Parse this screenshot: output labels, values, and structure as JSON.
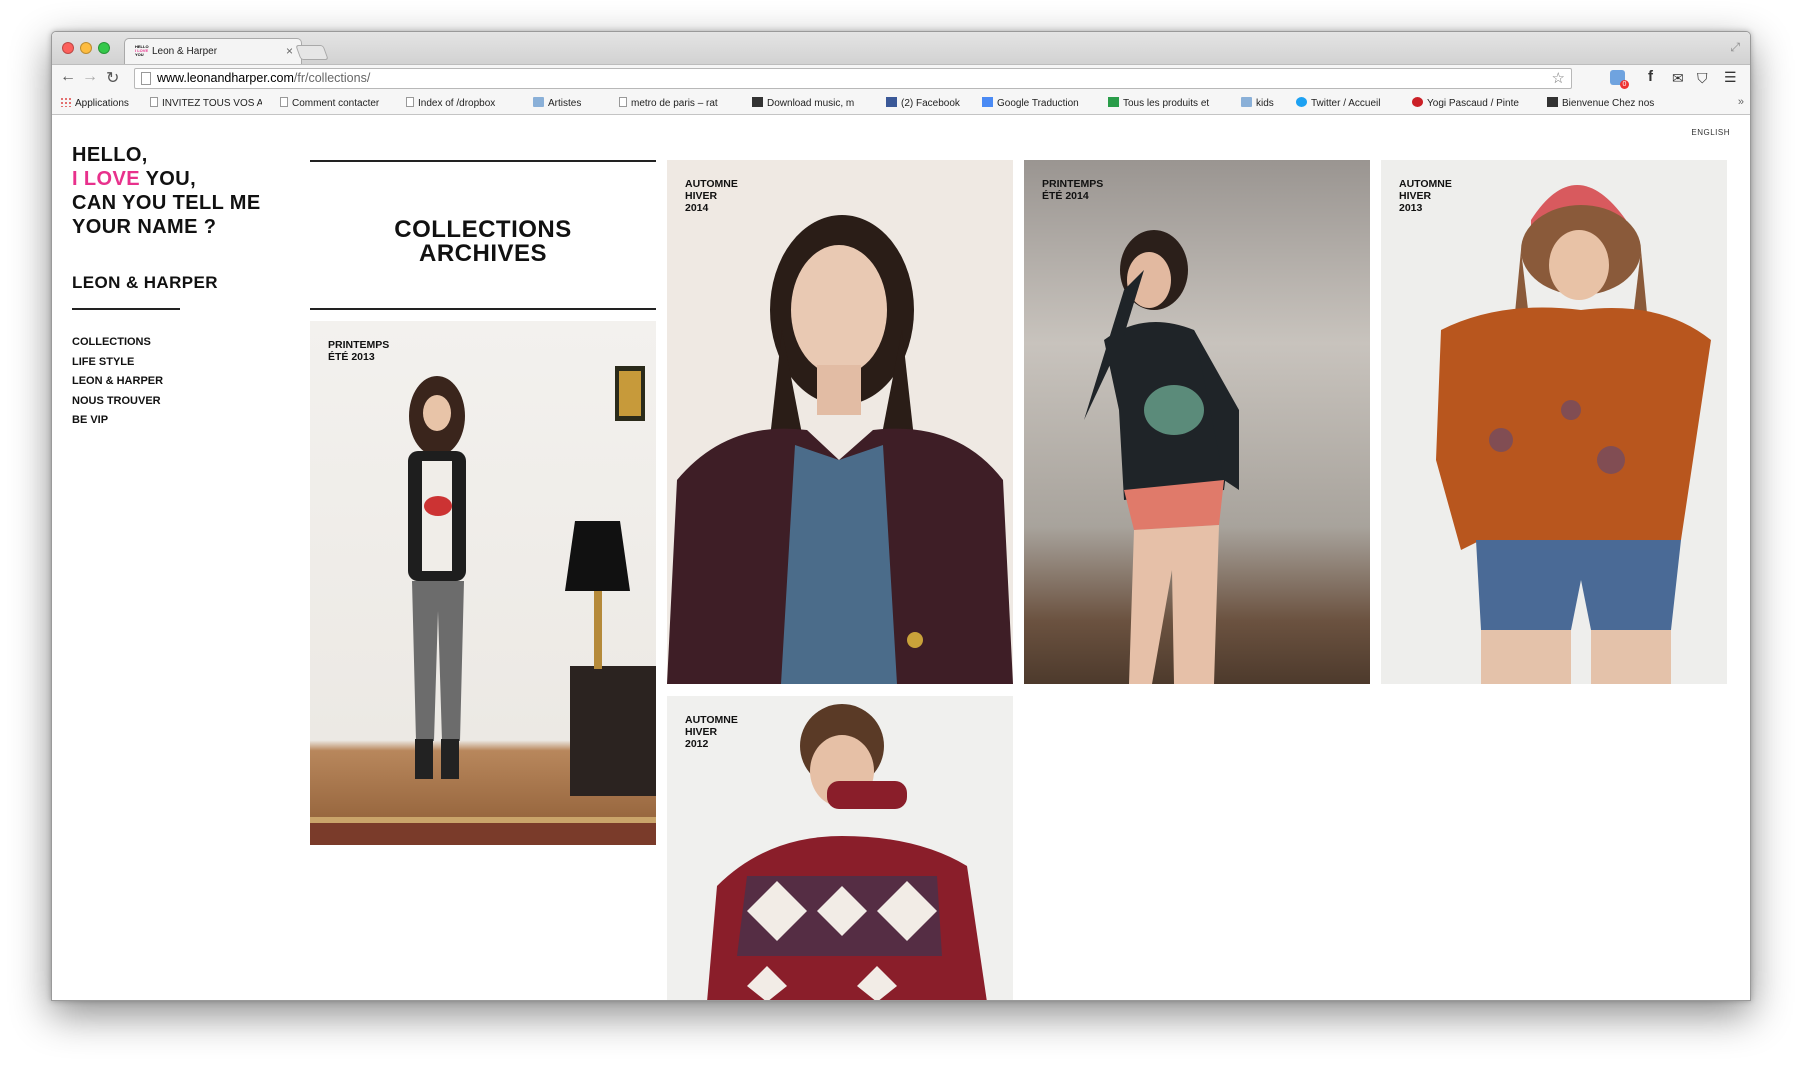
{
  "browser": {
    "tab_title": "Leon & Harper",
    "tab_favicon_text": "HELLO I LOVE YOU",
    "url_domain": "www.leonandharper.com",
    "url_path": "/fr/collections/",
    "bookmarks": [
      {
        "label": "Applications",
        "icon": "apps-icon"
      },
      {
        "label": "INVITEZ TOUS VOS A",
        "icon": "page-icon"
      },
      {
        "label": "Comment contacter",
        "icon": "page-icon"
      },
      {
        "label": "Index of /dropbox",
        "icon": "page-icon"
      },
      {
        "label": "Artistes",
        "icon": "folder-icon"
      },
      {
        "label": "metro de paris – rat",
        "icon": "page-icon"
      },
      {
        "label": "Download music, m",
        "icon": "printer-icon"
      },
      {
        "label": "(2) Facebook",
        "icon": "facebook-icon"
      },
      {
        "label": "Google Traduction",
        "icon": "translate-icon"
      },
      {
        "label": "Tous les produits et",
        "icon": "green-icon"
      },
      {
        "label": "kids",
        "icon": "folder-icon"
      },
      {
        "label": "Twitter / Accueil",
        "icon": "twitter-icon"
      },
      {
        "label": "Yogi Pascaud / Pinte",
        "icon": "pinterest-icon"
      },
      {
        "label": "Bienvenue Chez nos",
        "icon": "sparkle-icon"
      }
    ],
    "bookmarks_more": "»",
    "extension_badge": "0"
  },
  "site": {
    "lang_switch": "ENGLISH",
    "greeting": {
      "line1": "HELLO,",
      "line2_pink": "I LOVE",
      "line2_rest": " YOU,",
      "line3": "CAN YOU TELL ME",
      "line4": "YOUR NAME ?"
    },
    "brand": "LEON & HARPER",
    "nav": [
      "COLLECTIONS",
      "LIFE STYLE",
      "LEON & HARPER",
      "NOUS TROUVER",
      "BE VIP"
    ],
    "archives_title_line1": "COLLECTIONS",
    "archives_title_line2": "ARCHIVES",
    "collections": [
      {
        "line1": "PRINTEMPS",
        "line2": "ÉTÉ 2013",
        "line3": ""
      },
      {
        "line1": "AUTOMNE",
        "line2": "HIVER",
        "line3": "2014"
      },
      {
        "line1": "PRINTEMPS",
        "line2": "ÉTÉ 2014",
        "line3": ""
      },
      {
        "line1": "AUTOMNE",
        "line2": "HIVER",
        "line3": "2013"
      },
      {
        "line1": "AUTOMNE",
        "line2": "HIVER",
        "line3": "2012"
      }
    ]
  },
  "colors": {
    "accent_pink": "#e8318c",
    "text": "#111111"
  }
}
